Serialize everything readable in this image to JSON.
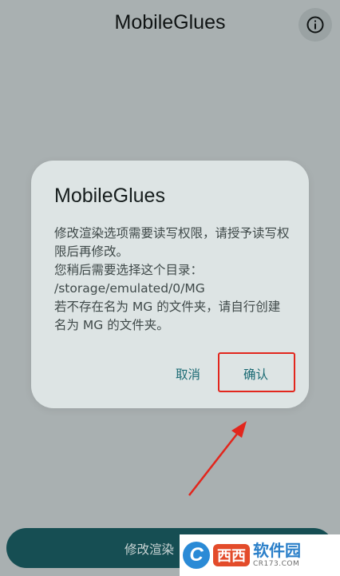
{
  "app": {
    "title": "MobileGlues"
  },
  "dialog": {
    "title": "MobileGlues",
    "message": "修改渲染选项需要读写权限，请授予读写权限后再修改。\n您稍后需要选择这个目录：\n/storage/emulated/0/MG\n若不存在名为 MG 的文件夹，请自行创建名为 MG 的文件夹。",
    "cancel_label": "取消",
    "confirm_label": "确认"
  },
  "bottom": {
    "button_label": "修改渲染"
  },
  "watermark": {
    "logo_letter": "C",
    "badge": "西西",
    "name": "软件园",
    "url": "CR173.COM"
  },
  "colors": {
    "background": "#a9b0b1",
    "dialog_bg": "#dde4e4",
    "accent": "#1a6a73",
    "primary_button": "#164e53",
    "highlight": "#e2261d"
  },
  "icons": {
    "info": "info-icon"
  }
}
